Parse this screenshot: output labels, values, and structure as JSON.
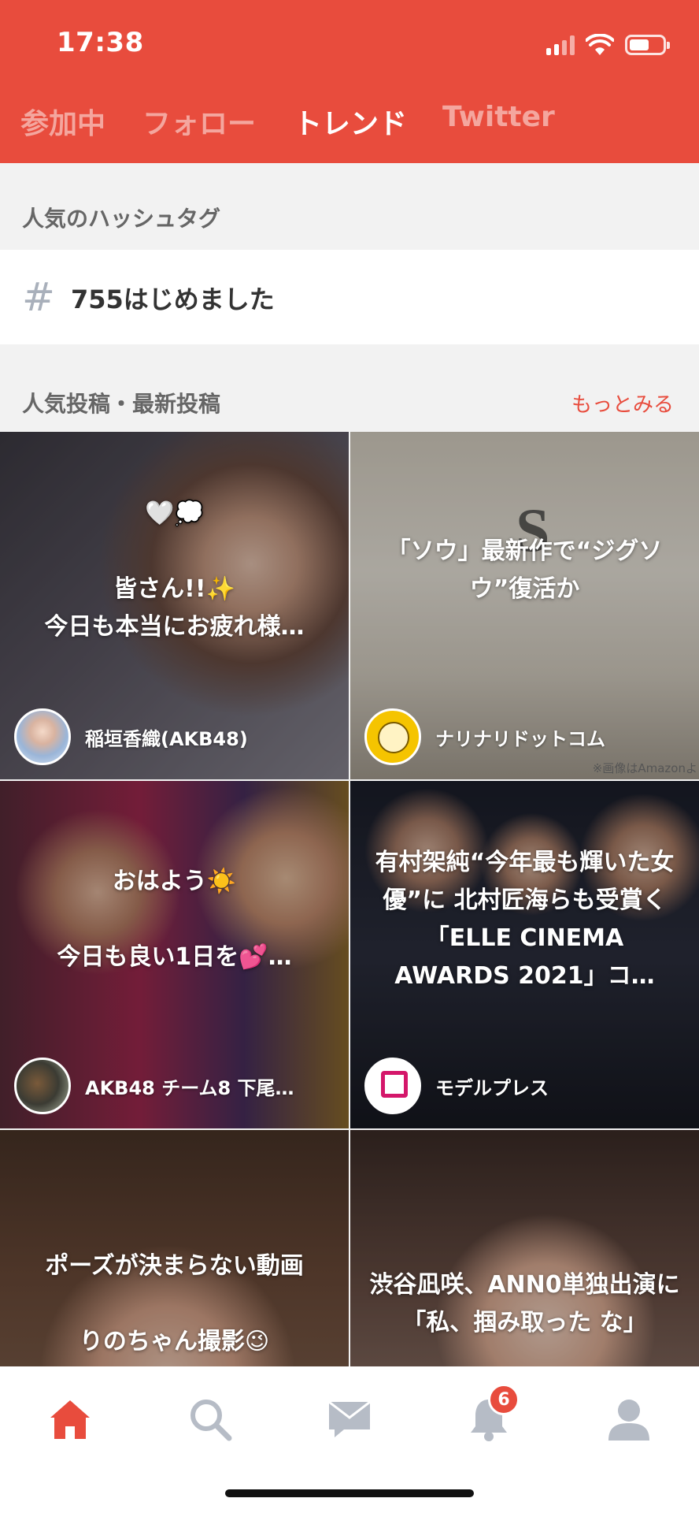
{
  "status_bar": {
    "time": "17:38"
  },
  "tabs": [
    {
      "label": "参加中"
    },
    {
      "label": "フォロー"
    },
    {
      "label": "トレンド"
    },
    {
      "label": "Twitter"
    }
  ],
  "hashtag_section": {
    "title": "人気のハッシュタグ",
    "hashtag": "755はじめました"
  },
  "posts_section": {
    "title": "人気投稿・最新投稿",
    "more_link": "もっとみる"
  },
  "cards": [
    {
      "caption": "🤍💭\n\n皆さん!!✨\n今日も本当にお疲れ様…",
      "author": "稲垣香織(AKB48)"
    },
    {
      "caption": "「ソウ」最新作で“ジグソウ”復活か",
      "author": "ナリナリドットコム",
      "note": "※画像はAmazonよ"
    },
    {
      "caption": "おはよう☀️\n\n今日も良い1日を💕…",
      "author": "AKB48 チーム8 下尾…"
    },
    {
      "caption": "有村架純“今年最も輝いた女優”に 北村匠海らも受賞く「ELLE CINEMA AWARDS 2021」コ…",
      "author": "モデルプレス"
    },
    {
      "caption": "ポーズが決まらない動画\n\nりのちゃん撮影😉",
      "author": ""
    },
    {
      "caption": "渋谷凪咲、ANN0単独出演に「私、掴み取った な」",
      "author": ""
    }
  ],
  "bottom_nav": {
    "items": [
      {
        "icon": "home-icon",
        "active": true
      },
      {
        "icon": "search-icon"
      },
      {
        "icon": "mail-icon"
      },
      {
        "icon": "bell-icon",
        "badge": "6"
      },
      {
        "icon": "profile-icon"
      }
    ]
  },
  "colors": {
    "brand": "#e84c3d",
    "inactive_icon": "#b6bcc6"
  }
}
